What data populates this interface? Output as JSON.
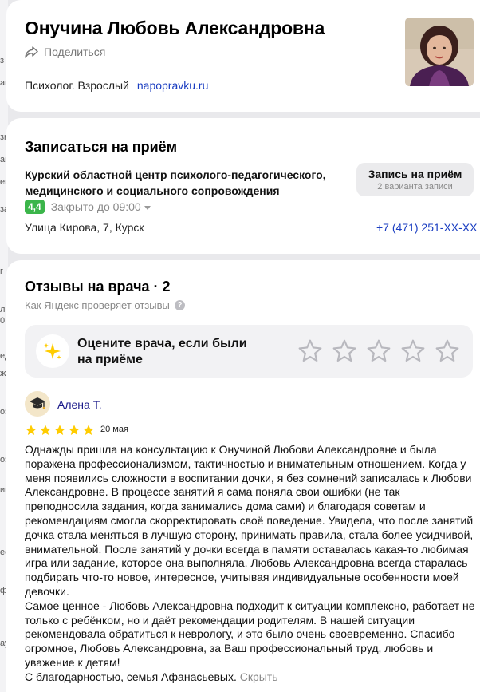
{
  "doctor": {
    "name": "Онучина Любовь Александровна",
    "share_label": "Поделиться",
    "specialty": "Психолог. Взрослый",
    "source_link": "napopravku.ru"
  },
  "booking": {
    "title": "Записаться на приём",
    "clinic_name": "Курский областной центр психолого-педагогического, медицинского и социального сопровождения",
    "rating": "4,4",
    "hours": "Закрыто до 09:00",
    "address": "Улица Кирова, 7, Курск",
    "phone": "+7 (471) 251-XX-XX",
    "button_label": "Запись на приём",
    "button_sub": "2 варианта записи"
  },
  "reviews": {
    "title": "Отзывы на врача · 2",
    "check_label": "Как Яндекс проверяет отзывы",
    "rate_prompt": "Оцените врача, если были на приёме",
    "rate_stars_count": 5,
    "items": [
      {
        "author": "Алена Т.",
        "stars": 5,
        "date": "20 мая",
        "text_p1": "Однажды пришла на консультацию к Онучиной Любови Александровне и была поражена профессионализмом, тактичностью и внимательным отношением. Когда у меня появились сложности в воспитании дочки, я без сомнений записалась к Любови Александровне. В процессе занятий я сама поняла свои ошибки (не так преподносила задания, когда занимались дома сами) и благодаря советам и рекомендациям смогла скорректировать своё поведение. Увидела, что после занятий дочка стала меняться в лучшую сторону, принимать правила, стала более усидчивой, внимательной. После занятий у дочки всегда в памяти оставалась какая-то любимая игра или задание, которое она выполняла. Любовь Александровна всегда старалась подбирать что-то новое, интересное, учитывая индивидуальные особенности моей девочки.",
        "text_p2": "Самое ценное - Любовь Александровна подходит к ситуации комплексно, работает не только с ребёнком, но и даёт рекомендации родителям. В нашей ситуации рекомендовала обратиться к неврологу, и это было очень своевременно. Спасибо огромное, Любовь Александровна, за Ваш профессиональный труд, любовь и уважение к детям!",
        "text_p3": "С благодарностью, семья Афанасьевых.",
        "hide_label": "Скрыть"
      }
    ]
  },
  "left_strip_glyphs": [
    "з",
    "ак",
    "зн",
    "ай",
    "ен",
    "за",
    "г",
    "ли",
    "0",
    "ед",
    "ж",
    "оз",
    "оз",
    "ий",
    "ес",
    "ф",
    "ау"
  ],
  "colors": {
    "link": "#1a3dc1",
    "rating_badge": "#3bb54a",
    "star_filled": "#ffcc00",
    "star_empty_stroke": "#b8b8be",
    "page_bg": "#e9e9ec"
  }
}
